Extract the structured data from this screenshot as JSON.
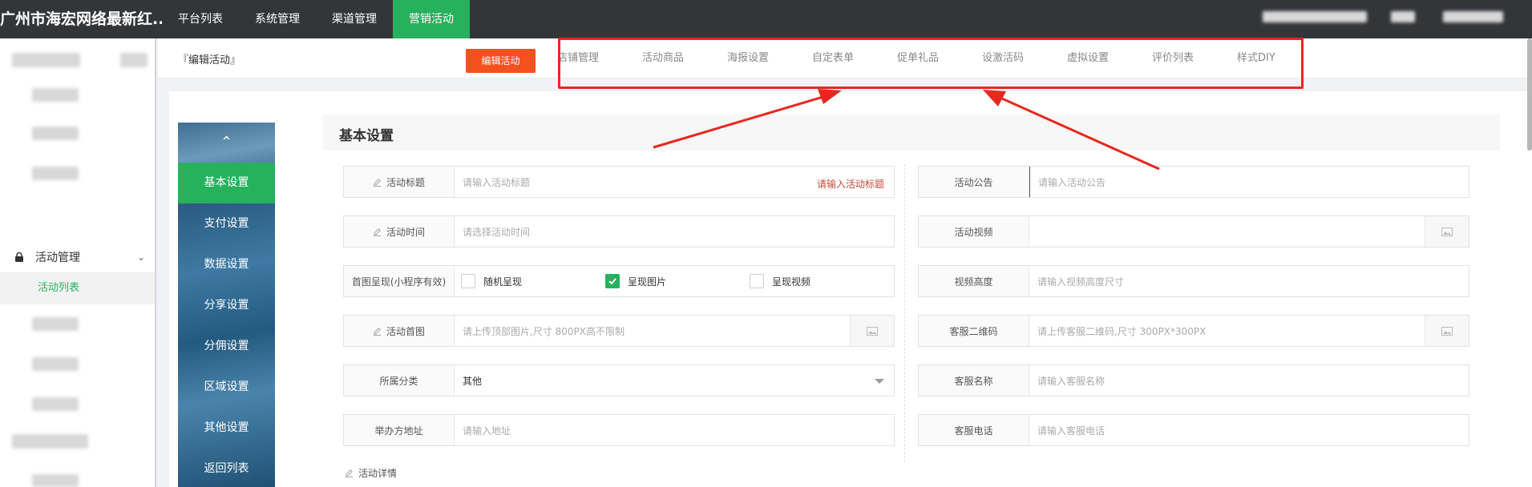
{
  "brand": "广州市海宏网络最新红...",
  "top_nav": [
    "平台列表",
    "系统管理",
    "渠道管理",
    "营销活动"
  ],
  "sidebar": {
    "group_label": "活动管理",
    "sub_label": "活动列表"
  },
  "header": {
    "page_label": "『编辑活动』",
    "edit_button": "编辑活动",
    "tabs": [
      "店铺管理",
      "活动商品",
      "海报设置",
      "自定表单",
      "促单礼品",
      "设激活码",
      "虚拟设置",
      "评价列表",
      "样式DIY"
    ]
  },
  "vertical_menu": [
    "基本设置",
    "支付设置",
    "数据设置",
    "分享设置",
    "分佣设置",
    "区域设置",
    "其他设置",
    "返回列表"
  ],
  "section_title": "基本设置",
  "form": {
    "title_label": "活动标题",
    "title_placeholder": "请输入活动标题",
    "title_error": "请输入活动标题",
    "time_label": "活动时间",
    "time_placeholder": "请选择活动时间",
    "display_label": "首图呈现(小程序有效)",
    "display_options": [
      {
        "label": "随机呈现",
        "checked": false
      },
      {
        "label": "呈现图片",
        "checked": true
      },
      {
        "label": "呈现视频",
        "checked": false
      }
    ],
    "cover_label": "活动首图",
    "cover_placeholder": "请上传顶部图片,尺寸 800PX高不限制",
    "category_label": "所属分类",
    "category_value": "其他",
    "address_label": "举办方地址",
    "address_placeholder": "请输入地址",
    "notice_label": "活动公告",
    "notice_placeholder": "请输入活动公告",
    "video_label": "活动视频",
    "video_height_label": "视频高度",
    "video_height_placeholder": "请输入视频高度尺寸",
    "qrcode_label": "客服二维码",
    "qrcode_placeholder": "请上传客服二维码,尺寸 300PX*300PX",
    "service_name_label": "客服名称",
    "service_name_placeholder": "请输入客服名称",
    "service_phone_label": "客服电话",
    "service_phone_placeholder": "请输入客服电话",
    "detail_label": "活动详情"
  },
  "colors": {
    "accent_green": "#26b15d",
    "edit_button": "#f4511e",
    "highlight": "#e8281e"
  }
}
